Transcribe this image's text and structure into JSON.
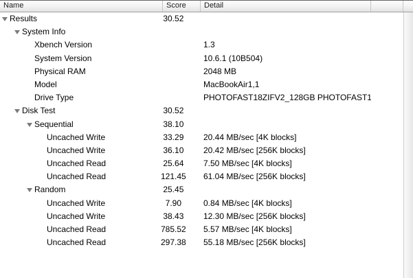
{
  "header": {
    "columns": [
      {
        "label": "Name"
      },
      {
        "label": "Score"
      },
      {
        "label": "Detail"
      }
    ]
  },
  "colors": {
    "triangle": "#7b7b7b",
    "header_border_top": "#636363",
    "header_border_bottom": "#9f9f9f",
    "scrollbar_track_border": "#cccccc"
  },
  "rows": [
    {
      "name": "Results",
      "level": 0,
      "expandable": true,
      "score": "30.52",
      "detail": ""
    },
    {
      "name": "System Info",
      "level": 1,
      "expandable": true,
      "score": "",
      "detail": ""
    },
    {
      "name": "Xbench Version",
      "level": 2,
      "expandable": false,
      "score": "",
      "detail": "1.3"
    },
    {
      "name": "System Version",
      "level": 2,
      "expandable": false,
      "score": "",
      "detail": "10.6.1 (10B504)"
    },
    {
      "name": "Physical RAM",
      "level": 2,
      "expandable": false,
      "score": "",
      "detail": "2048 MB"
    },
    {
      "name": "Model",
      "level": 2,
      "expandable": false,
      "score": "",
      "detail": "MacBookAir1,1"
    },
    {
      "name": "Drive Type",
      "level": 2,
      "expandable": false,
      "score": "",
      "detail": "PHOTOFAST18ZIFV2_128GB PHOTOFAST1"
    },
    {
      "name": "Disk Test",
      "level": 1,
      "expandable": true,
      "score": "30.52",
      "detail": ""
    },
    {
      "name": "Sequential",
      "level": 2,
      "expandable": true,
      "score": "38.10",
      "detail": ""
    },
    {
      "name": "Uncached Write",
      "level": 3,
      "expandable": false,
      "score": "33.29",
      "detail": "20.44 MB/sec [4K blocks]"
    },
    {
      "name": "Uncached Write",
      "level": 3,
      "expandable": false,
      "score": "36.10",
      "detail": "20.42 MB/sec [256K blocks]"
    },
    {
      "name": "Uncached Read",
      "level": 3,
      "expandable": false,
      "score": "25.64",
      "detail": "7.50 MB/sec [4K blocks]"
    },
    {
      "name": "Uncached Read",
      "level": 3,
      "expandable": false,
      "score": "121.45",
      "detail": "61.04 MB/sec [256K blocks]"
    },
    {
      "name": "Random",
      "level": 2,
      "expandable": true,
      "score": "25.45",
      "detail": ""
    },
    {
      "name": "Uncached Write",
      "level": 3,
      "expandable": false,
      "score": "7.90",
      "detail": "0.84 MB/sec [4K blocks]"
    },
    {
      "name": "Uncached Write",
      "level": 3,
      "expandable": false,
      "score": "38.43",
      "detail": "12.30 MB/sec [256K blocks]"
    },
    {
      "name": "Uncached Read",
      "level": 3,
      "expandable": false,
      "score": "785.52",
      "detail": "5.57 MB/sec [4K blocks]"
    },
    {
      "name": "Uncached Read",
      "level": 3,
      "expandable": false,
      "score": "297.38",
      "detail": "55.18 MB/sec [256K blocks]"
    }
  ]
}
